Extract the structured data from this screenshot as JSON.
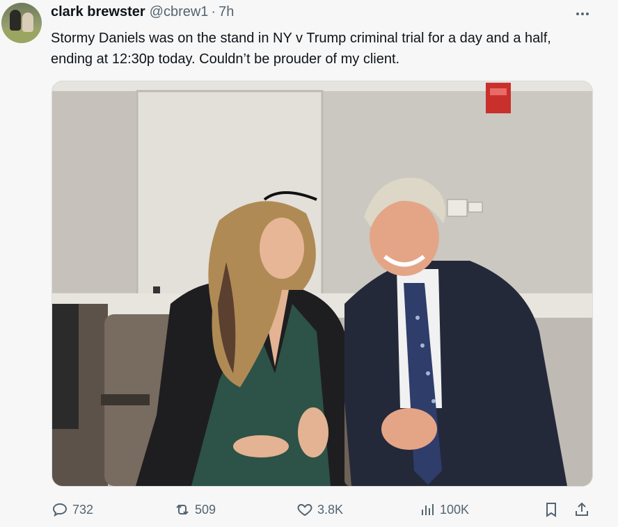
{
  "author": {
    "name": "clark brewster",
    "handle": "@cbrew1",
    "separator": "·",
    "time": "7h"
  },
  "tweet": {
    "text": "Stormy Daniels  was on the stand in NY v Trump criminal trial for a day and a half, ending at 12:30p  today.  Couldn’t be prouder of my client."
  },
  "media": {
    "type": "photo"
  },
  "actions": {
    "replies": "732",
    "reposts": "509",
    "likes": "3.8K",
    "views": "100K"
  },
  "icons": {
    "more": "more-horizontal-icon",
    "reply": "speech-bubble-icon",
    "repost": "repost-arrows-icon",
    "like": "heart-icon",
    "views": "bar-chart-icon",
    "bookmark": "bookmark-icon",
    "share": "share-upload-icon"
  },
  "colors": {
    "background": "#f7f7f7",
    "text": "#0f1419",
    "muted": "#536471"
  }
}
